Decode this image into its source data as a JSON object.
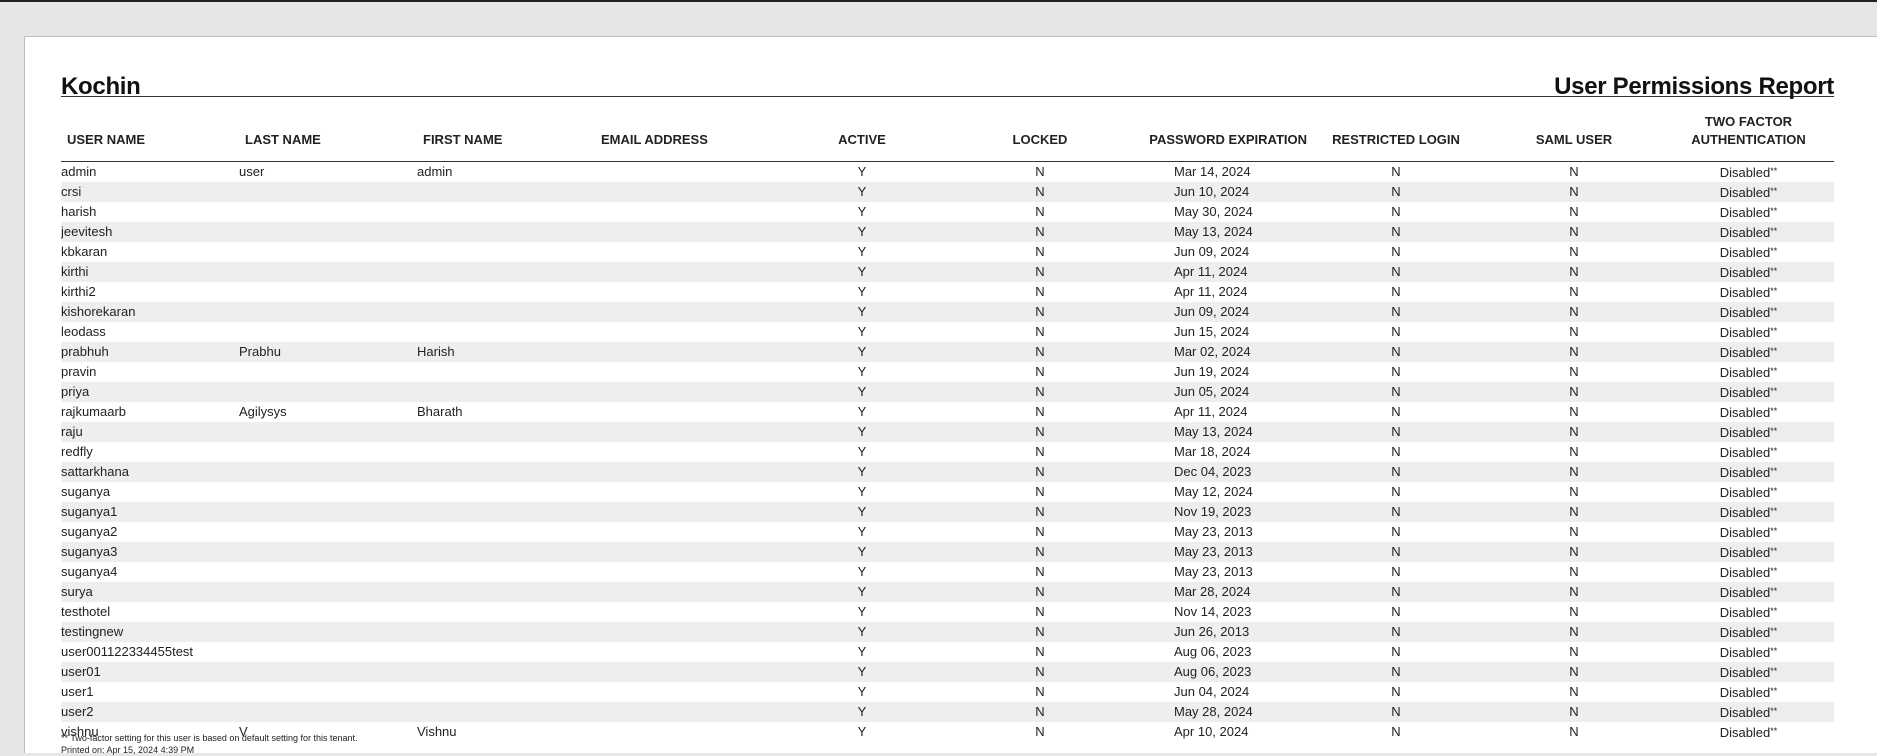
{
  "report": {
    "org_name": "Kochin",
    "title": "User Permissions Report"
  },
  "table": {
    "headers": {
      "user_name": "USER NAME",
      "last_name": "LAST NAME",
      "first_name": "FIRST NAME",
      "email": "EMAIL ADDRESS",
      "active": "ACTIVE",
      "locked": "LOCKED",
      "password_expiration": "PASSWORD EXPIRATION",
      "restricted_login": "RESTRICTED LOGIN",
      "saml_user": "SAML USER",
      "two_factor_line1": "TWO FACTOR",
      "two_factor_line2": "AUTHENTICATION"
    },
    "rows": [
      {
        "user": "admin",
        "last": "user",
        "first": "admin",
        "email": "",
        "active": "Y",
        "locked": "N",
        "expiry": "Mar 14, 2024",
        "restricted": "N",
        "saml": "N",
        "twofactor": "Disabled",
        "mark": "**"
      },
      {
        "user": "crsi",
        "last": "",
        "first": "",
        "email": "",
        "active": "Y",
        "locked": "N",
        "expiry": "Jun 10, 2024",
        "restricted": "N",
        "saml": "N",
        "twofactor": "Disabled",
        "mark": "**"
      },
      {
        "user": "harish",
        "last": "",
        "first": "",
        "email": "",
        "active": "Y",
        "locked": "N",
        "expiry": "May 30, 2024",
        "restricted": "N",
        "saml": "N",
        "twofactor": "Disabled",
        "mark": "**"
      },
      {
        "user": "jeevitesh",
        "last": "",
        "first": "",
        "email": "",
        "active": "Y",
        "locked": "N",
        "expiry": "May 13, 2024",
        "restricted": "N",
        "saml": "N",
        "twofactor": "Disabled",
        "mark": "**"
      },
      {
        "user": "kbkaran",
        "last": "",
        "first": "",
        "email": "",
        "active": "Y",
        "locked": "N",
        "expiry": "Jun 09, 2024",
        "restricted": "N",
        "saml": "N",
        "twofactor": "Disabled",
        "mark": "**"
      },
      {
        "user": "kirthi",
        "last": "",
        "first": "",
        "email": "",
        "active": "Y",
        "locked": "N",
        "expiry": "Apr 11, 2024",
        "restricted": "N",
        "saml": "N",
        "twofactor": "Disabled",
        "mark": "**"
      },
      {
        "user": "kirthi2",
        "last": "",
        "first": "",
        "email": "",
        "active": "Y",
        "locked": "N",
        "expiry": "Apr 11, 2024",
        "restricted": "N",
        "saml": "N",
        "twofactor": "Disabled",
        "mark": "**"
      },
      {
        "user": "kishorekaran",
        "last": "",
        "first": "",
        "email": "",
        "active": "Y",
        "locked": "N",
        "expiry": "Jun 09, 2024",
        "restricted": "N",
        "saml": "N",
        "twofactor": "Disabled",
        "mark": "**"
      },
      {
        "user": "leodass",
        "last": "",
        "first": "",
        "email": "",
        "active": "Y",
        "locked": "N",
        "expiry": "Jun 15, 2024",
        "restricted": "N",
        "saml": "N",
        "twofactor": "Disabled",
        "mark": "**"
      },
      {
        "user": "prabhuh",
        "last": "Prabhu",
        "first": "Harish",
        "email": "",
        "active": "Y",
        "locked": "N",
        "expiry": "Mar 02, 2024",
        "restricted": "N",
        "saml": "N",
        "twofactor": "Disabled",
        "mark": "**"
      },
      {
        "user": "pravin",
        "last": "",
        "first": "",
        "email": "",
        "active": "Y",
        "locked": "N",
        "expiry": "Jun 19, 2024",
        "restricted": "N",
        "saml": "N",
        "twofactor": "Disabled",
        "mark": "**"
      },
      {
        "user": "priya",
        "last": "",
        "first": "",
        "email": "",
        "active": "Y",
        "locked": "N",
        "expiry": "Jun 05, 2024",
        "restricted": "N",
        "saml": "N",
        "twofactor": "Disabled",
        "mark": "**"
      },
      {
        "user": "rajkumaarb",
        "last": "Agilysys",
        "first": "Bharath",
        "email": "",
        "active": "Y",
        "locked": "N",
        "expiry": "Apr 11, 2024",
        "restricted": "N",
        "saml": "N",
        "twofactor": "Disabled",
        "mark": "**"
      },
      {
        "user": "raju",
        "last": "",
        "first": "",
        "email": "",
        "active": "Y",
        "locked": "N",
        "expiry": "May 13, 2024",
        "restricted": "N",
        "saml": "N",
        "twofactor": "Disabled",
        "mark": "**"
      },
      {
        "user": "redfly",
        "last": "",
        "first": "",
        "email": "",
        "active": "Y",
        "locked": "N",
        "expiry": "Mar 18, 2024",
        "restricted": "N",
        "saml": "N",
        "twofactor": "Disabled",
        "mark": "**"
      },
      {
        "user": "sattarkhana",
        "last": "",
        "first": "",
        "email": "",
        "active": "Y",
        "locked": "N",
        "expiry": "Dec 04, 2023",
        "restricted": "N",
        "saml": "N",
        "twofactor": "Disabled",
        "mark": "**"
      },
      {
        "user": "suganya",
        "last": "",
        "first": "",
        "email": "",
        "active": "Y",
        "locked": "N",
        "expiry": "May 12, 2024",
        "restricted": "N",
        "saml": "N",
        "twofactor": "Disabled",
        "mark": "**"
      },
      {
        "user": "suganya1",
        "last": "",
        "first": "",
        "email": "",
        "active": "Y",
        "locked": "N",
        "expiry": "Nov 19, 2023",
        "restricted": "N",
        "saml": "N",
        "twofactor": "Disabled",
        "mark": "**"
      },
      {
        "user": "suganya2",
        "last": "",
        "first": "",
        "email": "",
        "active": "Y",
        "locked": "N",
        "expiry": "May 23, 2013",
        "restricted": "N",
        "saml": "N",
        "twofactor": "Disabled",
        "mark": "**"
      },
      {
        "user": "suganya3",
        "last": "",
        "first": "",
        "email": "",
        "active": "Y",
        "locked": "N",
        "expiry": "May 23, 2013",
        "restricted": "N",
        "saml": "N",
        "twofactor": "Disabled",
        "mark": "**"
      },
      {
        "user": "suganya4",
        "last": "",
        "first": "",
        "email": "",
        "active": "Y",
        "locked": "N",
        "expiry": "May 23, 2013",
        "restricted": "N",
        "saml": "N",
        "twofactor": "Disabled",
        "mark": "**"
      },
      {
        "user": "surya",
        "last": "",
        "first": "",
        "email": "",
        "active": "Y",
        "locked": "N",
        "expiry": "Mar 28, 2024",
        "restricted": "N",
        "saml": "N",
        "twofactor": "Disabled",
        "mark": "**"
      },
      {
        "user": "testhotel",
        "last": "",
        "first": "",
        "email": "",
        "active": "Y",
        "locked": "N",
        "expiry": "Nov 14, 2023",
        "restricted": "N",
        "saml": "N",
        "twofactor": "Disabled",
        "mark": "**"
      },
      {
        "user": "testingnew",
        "last": "",
        "first": "",
        "email": "",
        "active": "Y",
        "locked": "N",
        "expiry": "Jun 26, 2013",
        "restricted": "N",
        "saml": "N",
        "twofactor": "Disabled",
        "mark": "**"
      },
      {
        "user": "user001122334455test",
        "last": "",
        "first": "",
        "email": "",
        "active": "Y",
        "locked": "N",
        "expiry": "Aug 06, 2023",
        "restricted": "N",
        "saml": "N",
        "twofactor": "Disabled",
        "mark": "**"
      },
      {
        "user": "user01",
        "last": "",
        "first": "",
        "email": "",
        "active": "Y",
        "locked": "N",
        "expiry": "Aug 06, 2023",
        "restricted": "N",
        "saml": "N",
        "twofactor": "Disabled",
        "mark": "**"
      },
      {
        "user": "user1",
        "last": "",
        "first": "",
        "email": "",
        "active": "Y",
        "locked": "N",
        "expiry": "Jun 04, 2024",
        "restricted": "N",
        "saml": "N",
        "twofactor": "Disabled",
        "mark": "**"
      },
      {
        "user": "user2",
        "last": "",
        "first": "",
        "email": "",
        "active": "Y",
        "locked": "N",
        "expiry": "May 28, 2024",
        "restricted": "N",
        "saml": "N",
        "twofactor": "Disabled",
        "mark": "**"
      },
      {
        "user": "vishnu",
        "last": "V",
        "first": "Vishnu",
        "email": "",
        "active": "Y",
        "locked": "N",
        "expiry": "Apr 10, 2024",
        "restricted": "N",
        "saml": "N",
        "twofactor": "Disabled",
        "mark": "**"
      }
    ]
  },
  "footer": {
    "note": "** Two-factor setting for this user is based on default setting for this tenant.",
    "printed": "Printed on: Apr 15, 2024 4:39 PM"
  }
}
